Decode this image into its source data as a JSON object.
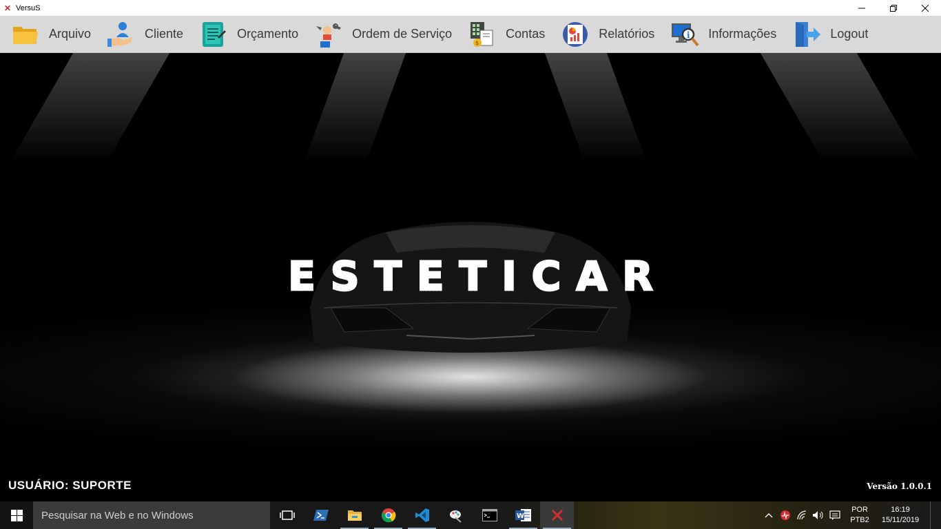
{
  "window": {
    "title": "VersuS",
    "app_icon": "x-logo-icon",
    "controls": [
      "minimize-icon",
      "restore-icon",
      "close-icon"
    ]
  },
  "menu": {
    "items": [
      {
        "label": "Arquivo",
        "icon": "folder-icon"
      },
      {
        "label": "Cliente",
        "icon": "client-icon"
      },
      {
        "label": "Orçamento",
        "icon": "document-icon"
      },
      {
        "label": "Ordem de Serviço",
        "icon": "service-tools-icon"
      },
      {
        "label": "Contas",
        "icon": "accounts-calculator-icon"
      },
      {
        "label": "Relatórios",
        "icon": "reports-chart-icon"
      },
      {
        "label": "Informações",
        "icon": "info-search-icon"
      },
      {
        "label": "Logout",
        "icon": "logout-door-icon"
      }
    ]
  },
  "main": {
    "brand": "ESTETICAR",
    "user_label": "USUÁRIO:  SUPORTE",
    "version": "Versão 1.0.0.1"
  },
  "taskbar": {
    "search_placeholder": "Pesquisar na Web e no Windows",
    "apps": [
      "task-view-icon",
      "powershell-icon",
      "file-explorer-icon",
      "chrome-icon",
      "vscode-icon",
      "paint-icon",
      "terminal-icon",
      "word-icon",
      "versus-app-icon"
    ],
    "lang_line1": "POR",
    "lang_line2": "PTB2",
    "time": "16:19",
    "date": "15/11/2019"
  },
  "colors": {
    "menubar_bg": "#d9d9d9",
    "main_bg": "#000000",
    "taskbar_bg": "#1a1a1a",
    "accent_red": "#c62828"
  }
}
